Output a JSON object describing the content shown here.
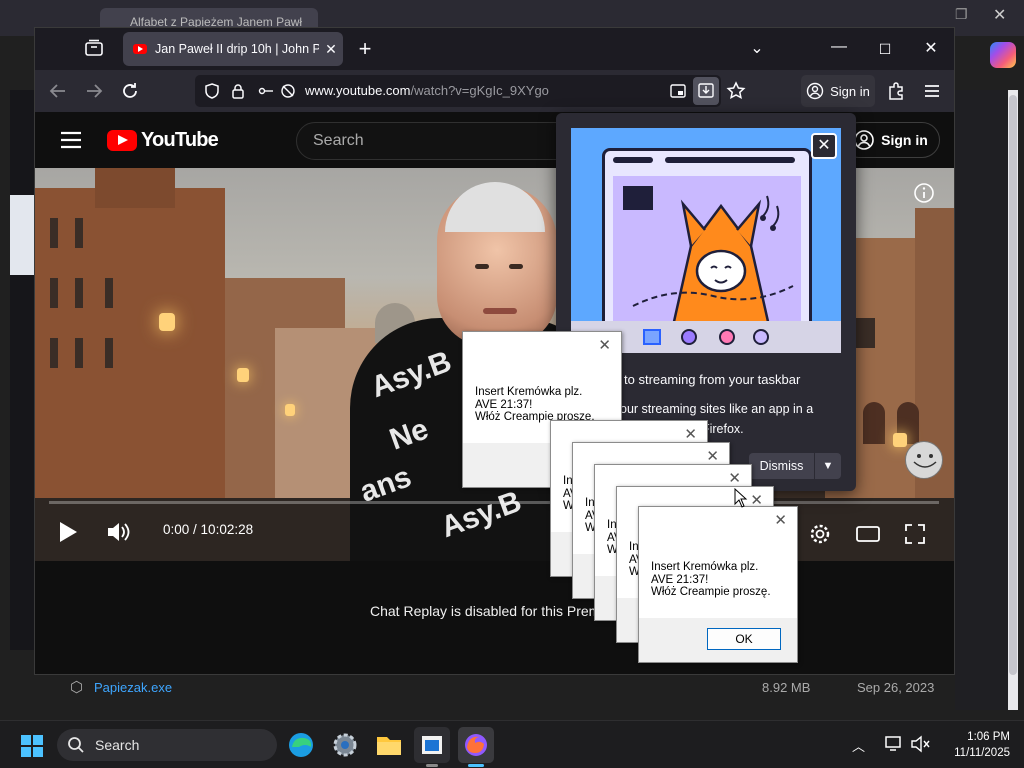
{
  "background_window": {
    "tab_title": "Alfabet z Papieżem Janem Pawł"
  },
  "firefox": {
    "tab": {
      "title": "Jan Paweł II drip 10h | John Paul"
    },
    "url": {
      "host": "www.youtube.com",
      "path": "/watch?v=gKgIc_9XYgo"
    },
    "sign_in_label": "Sign in"
  },
  "youtube": {
    "logo_text": "YouTube",
    "search_placeholder": "Search",
    "sign_in_label": "Sign in",
    "player": {
      "time_current": "0:00",
      "time_sep": " / ",
      "time_total": "10:02:28"
    },
    "chat_replay_text": "Chat Replay is disabled for this Prem"
  },
  "firefox_popup": {
    "title": "to streaming from your taskbar",
    "description": "our streaming sites like an app in a\n        tected by Firefox.",
    "dismiss_label": "Dismiss"
  },
  "dialogs": {
    "message": "Insert Kremówka plz.\nAVE 21:37!\nWłóż Creampie proszę.",
    "ok_label": "OK",
    "partial_prefix_a": "Ins\nAV\nWł",
    "partial_prefix_b": "In\nAV\nW"
  },
  "file_list": {
    "name": "Papiezak.exe",
    "size": "8.92 MB",
    "date": "Sep 26, 2023"
  },
  "taskbar": {
    "search_label": "Search",
    "time": "1:06 PM",
    "date": "11/11/2025"
  },
  "colors": {
    "yt_red": "#ff0000",
    "firefox_toolbar": "#2b2a33",
    "link_blue": "#3ea6ff"
  }
}
